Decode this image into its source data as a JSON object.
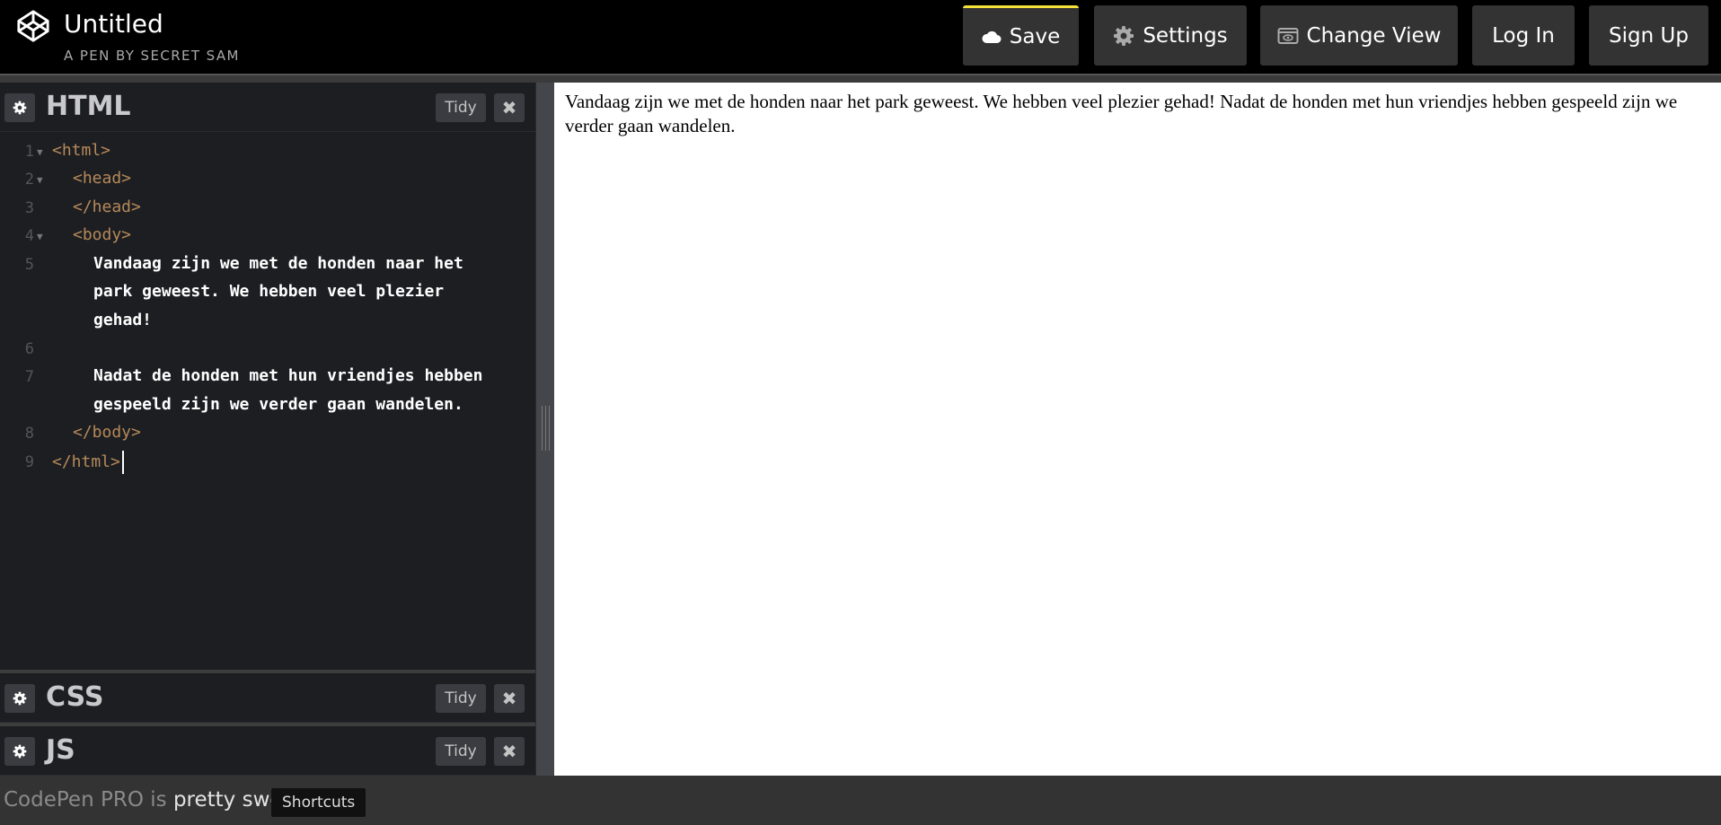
{
  "header": {
    "title": "Untitled",
    "subtitle": "A PEN BY SECRET SAM",
    "logo_icon": "codepen-logo-icon",
    "buttons": {
      "save": "Save",
      "settings": "Settings",
      "change_view": "Change View",
      "login": "Log In",
      "signup": "Sign Up"
    },
    "save_accent": "#f5e23a"
  },
  "editors": {
    "html": {
      "name": "HTML",
      "tidy": "Tidy",
      "close": "✖"
    },
    "css": {
      "name": "CSS",
      "tidy": "Tidy",
      "close": "✖"
    },
    "js": {
      "name": "JS",
      "tidy": "Tidy",
      "close": "✖"
    }
  },
  "code": {
    "line_numbers": [
      "1",
      "2",
      "3",
      "4",
      "5",
      "6",
      "7",
      "8",
      "9"
    ],
    "lines": {
      "l1": "<html>",
      "l2": "<head>",
      "l3": "</head>",
      "l4": "<body>",
      "l5a": "Vandaag zijn we met de honden naar het",
      "l5b": "park geweest. We hebben veel plezier",
      "l5c": "gehad!",
      "l7a": "Nadat de honden met hun vriendjes hebben",
      "l7b": "gespeeld zijn we verder gaan wandelen.",
      "l8": "</body>",
      "l9": "</html>"
    }
  },
  "preview": {
    "text": "Vandaag zijn we met de honden naar het park geweest. We hebben veel plezier gehad! Nadat de honden met hun vriendjes hebben gespeeld zijn we verder gaan wandelen."
  },
  "footer": {
    "promo_pre": "CodePen PRO",
    "promo_mid": " is ",
    "promo_post": "pretty sweet.",
    "shortcuts": "Shortcuts"
  }
}
